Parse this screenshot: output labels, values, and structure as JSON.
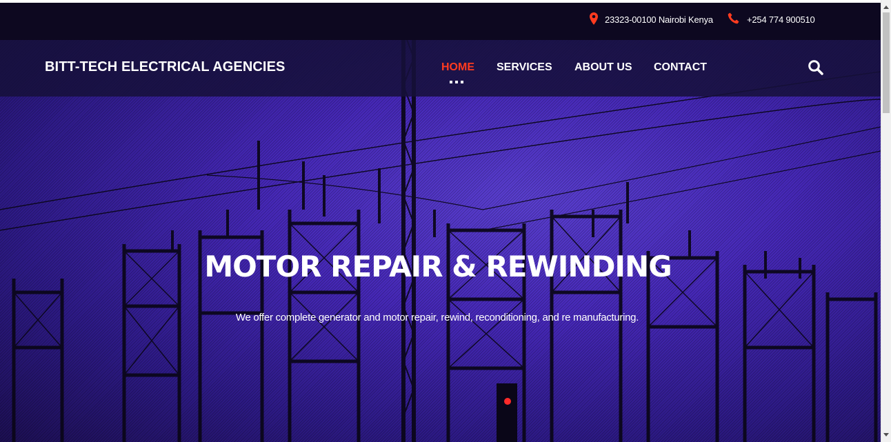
{
  "topbar": {
    "address": "23323-00100 Nairobi Kenya",
    "phone": "+254 774 900510",
    "address_icon": "map-marker-icon",
    "phone_icon": "phone-icon",
    "icon_color": "#ff3b1f"
  },
  "navbar": {
    "brand": "BITT-TECH ELECTRICAL AGENCIES",
    "items": [
      {
        "label": "HOME",
        "active": true
      },
      {
        "label": "SERVICES",
        "active": false
      },
      {
        "label": "ABOUT US",
        "active": false
      },
      {
        "label": "CONTACT",
        "active": false
      }
    ],
    "search_icon": "search-icon",
    "active_color": "#ff3b1f"
  },
  "hero": {
    "title": "MOTOR REPAIR & REWINDING",
    "subtitle": "We offer complete generator and motor repair, rewind, reconditioning, and re manufacturing.",
    "background_color": "#4628b8"
  }
}
